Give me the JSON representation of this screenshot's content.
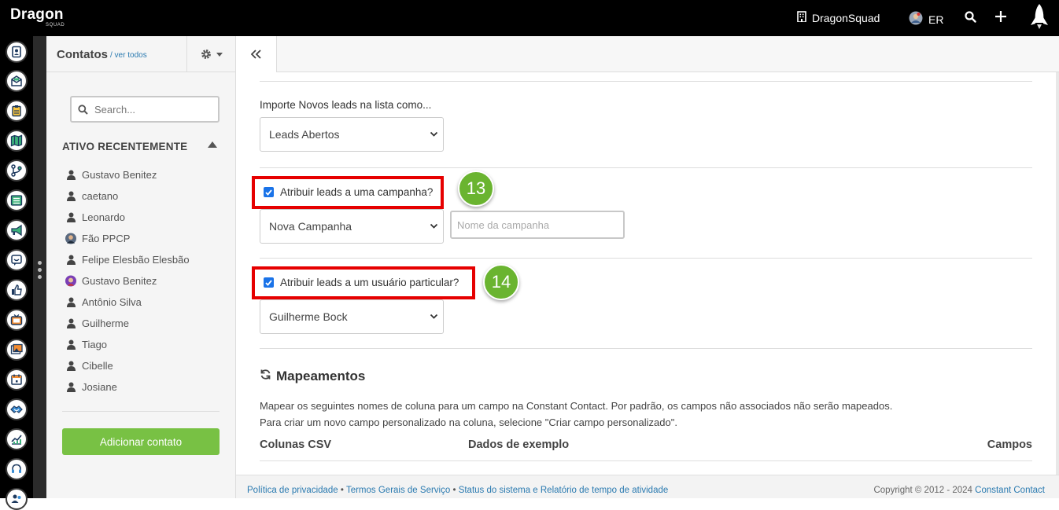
{
  "topbar": {
    "logo_main": "Dragon",
    "logo_sub": "SQUAD",
    "org_name": "DragonSquad",
    "user_initials": "ER"
  },
  "contacts": {
    "title": "Contatos",
    "view_all": "/ ver todos",
    "search_placeholder": "Search...",
    "section_label": "ATIVO RECENTEMENTE",
    "items": [
      {
        "name": "Gustavo Benitez",
        "avatar": "person-icon"
      },
      {
        "name": "caetano",
        "avatar": "person-icon"
      },
      {
        "name": "Leonardo",
        "avatar": "person-icon"
      },
      {
        "name": "Fão PPCP",
        "avatar": "photo-avatar"
      },
      {
        "name": "Felipe Elesbão Elesbão",
        "avatar": "person-icon"
      },
      {
        "name": "Gustavo Benitez",
        "avatar": "photo-avatar"
      },
      {
        "name": "Antônio Silva",
        "avatar": "person-icon"
      },
      {
        "name": "Guilherme",
        "avatar": "person-icon"
      },
      {
        "name": "Tiago",
        "avatar": "person-icon"
      },
      {
        "name": "Cibelle",
        "avatar": "person-icon"
      },
      {
        "name": "Josiane",
        "avatar": "person-icon"
      }
    ],
    "add_button": "Adicionar contato"
  },
  "form": {
    "import_label": "Importe Novos leads na lista como...",
    "import_select": "Leads Abertos",
    "campaign_check_label": "Atribuir leads a uma campanha?",
    "campaign_checked": true,
    "campaign_step": "13",
    "campaign_select": "Nova Campanha",
    "campaign_name_placeholder": "Nome da campanha",
    "user_check_label": "Atribuir leads a um usuário particular?",
    "user_checked": true,
    "user_step": "14",
    "user_select": "Guilherme Bock"
  },
  "mapping": {
    "title": "Mapeamentos",
    "desc_line1": "Mapear os seguintes nomes de coluna para um campo na Constant Contact. Por padrão, os campos não associados não serão mapeados.",
    "desc_line2": "Para criar um novo campo personalizado na coluna, selecione \"Criar campo personalizado\".",
    "col_csv": "Colunas CSV",
    "col_sample": "Dados de exemplo",
    "col_fields": "Campos"
  },
  "footer": {
    "privacy": "Política de privacidade",
    "terms": "Termos Gerais de Serviço",
    "status": "Status do sistema e Relatório de tempo de atividade",
    "separator": "•",
    "copyright": "Copyright © 2012 - 2024",
    "company": "Constant Contact"
  },
  "colors": {
    "accent_green": "#78c144",
    "highlight_red": "#e60000",
    "link_blue": "#2a7ab0",
    "checkbox_blue": "#1a73e8"
  }
}
